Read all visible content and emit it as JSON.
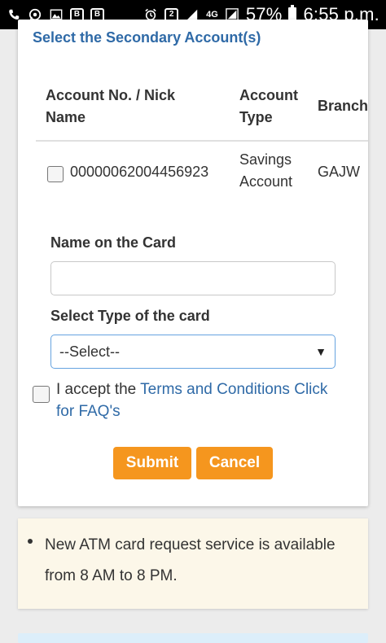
{
  "status_bar": {
    "icons": [
      "phone-icon",
      "whatsapp-icon",
      "gallery-icon",
      "b-app-icon",
      "b-app-icon",
      "alarm-icon",
      "sim-2-icon",
      "signal-icon",
      "lte-signal-icon"
    ],
    "sim_label": "2",
    "network_label": "4G",
    "battery": "57%",
    "time": "6:55 p.m."
  },
  "form": {
    "section_title": "Select the Secondary Account(s)",
    "table": {
      "headers": [
        "Account No. / Nick Name",
        "Account Type",
        "Branch"
      ],
      "rows": [
        {
          "account_no": "00000062004456923",
          "account_type": "Savings Account",
          "branch": "GAJW"
        }
      ]
    },
    "name_label": "Name on the Card",
    "name_value": "",
    "card_type_label": "Select Type of the card",
    "card_type_selected": "--Select--",
    "terms_prefix": "I accept the ",
    "terms_link": "Terms and Conditions",
    "faq_link": "Click for FAQ's",
    "submit_label": "Submit",
    "cancel_label": "Cancel"
  },
  "notice": {
    "text": "New ATM card request service is available from 8 AM to 8 PM."
  },
  "colors": {
    "accent": "#f5961e",
    "link": "#2f6aa7",
    "notice_bg": "#fcf7e9",
    "select_border": "#66a3e0"
  }
}
